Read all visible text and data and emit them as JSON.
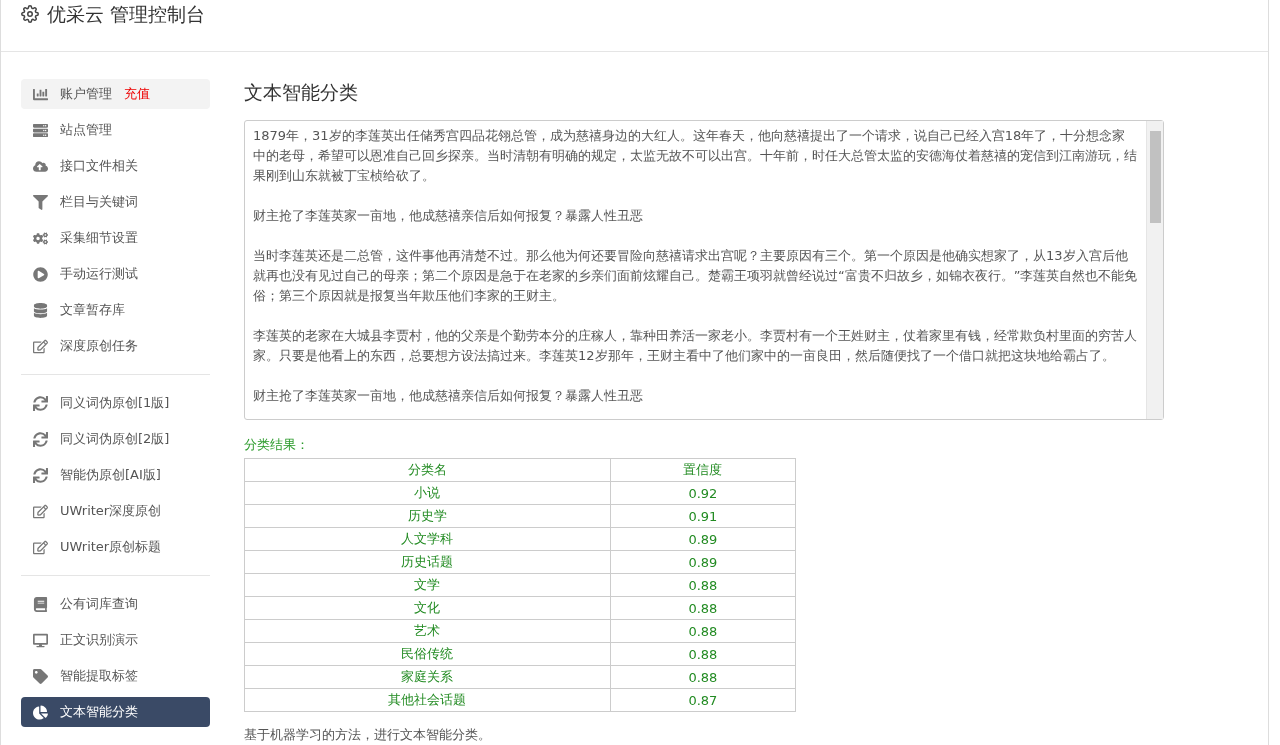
{
  "header": {
    "title": "优采云 管理控制台"
  },
  "sidebar": {
    "groups": [
      {
        "items": [
          {
            "label": "账户管理",
            "badge": "充值",
            "hovered": true,
            "selected": false
          },
          {
            "label": "站点管理",
            "hovered": false,
            "selected": false
          },
          {
            "label": "接口文件相关",
            "hovered": false,
            "selected": false
          },
          {
            "label": "栏目与关键词",
            "hovered": false,
            "selected": false
          },
          {
            "label": "采集细节设置",
            "hovered": false,
            "selected": false
          },
          {
            "label": "手动运行测试",
            "hovered": false,
            "selected": false
          },
          {
            "label": "文章暂存库",
            "hovered": false,
            "selected": false
          },
          {
            "label": "深度原创任务",
            "hovered": false,
            "selected": false
          }
        ]
      },
      {
        "items": [
          {
            "label": "同义词伪原创[1版]",
            "hovered": false,
            "selected": false
          },
          {
            "label": "同义词伪原创[2版]",
            "hovered": false,
            "selected": false
          },
          {
            "label": "智能伪原创[AI版]",
            "hovered": false,
            "selected": false
          },
          {
            "label": "UWriter深度原创",
            "hovered": false,
            "selected": false
          },
          {
            "label": "UWriter原创标题",
            "hovered": false,
            "selected": false
          }
        ]
      },
      {
        "items": [
          {
            "label": "公有词库查询",
            "hovered": false,
            "selected": false
          },
          {
            "label": "正文识别演示",
            "hovered": false,
            "selected": false
          },
          {
            "label": "智能提取标签",
            "hovered": false,
            "selected": false
          },
          {
            "label": "文本智能分类",
            "hovered": false,
            "selected": true
          }
        ]
      }
    ]
  },
  "main": {
    "title": "文本智能分类",
    "text_input": {
      "paragraphs": [
        "1879年，31岁的李莲英出任储秀宫四品花翎总管，成为慈禧身边的大红人。这年春天，他向慈禧提出了一个请求，说自己已经入宫18年了，十分想念家中的老母，希望可以恩准自己回乡探亲。当时清朝有明确的规定，太监无故不可以出宫。十年前，时任大总管太监的安德海仗着慈禧的宠信到江南游玩，结果刚到山东就被丁宝桢给砍了。",
        "财主抢了李莲英家一亩地，他成慈禧亲信后如何报复？暴露人性丑恶",
        "当时李莲英还是二总管，这件事他再清楚不过。那么他为何还要冒险向慈禧请求出宫呢？主要原因有三个。第一个原因是他确实想家了，从13岁入宫后他就再也没有见过自己的母亲；第二个原因是急于在老家的乡亲们面前炫耀自己。楚霸王项羽就曾经说过“富贵不归故乡，如锦衣夜行。”李莲英自然也不能免俗；第三个原因就是报复当年欺压他们李家的王财主。",
        "李莲英的老家在大城县李贾村，他的父亲是个勤劳本分的庄稼人，靠种田养活一家老小。李贾村有一个王姓财主，仗着家里有钱，经常欺负村里面的穷苦人家。只要是他看上的东西，总要想方设法搞过来。李莲英12岁那年，王财主看中了他们家中的一亩良田，然后随便找了一个借口就把这块地给霸占了。",
        "财主抢了李莲英家一亩地，他成慈禧亲信后如何报复？暴露人性丑恶"
      ]
    },
    "result_label": "分类结果：",
    "table": {
      "columns": [
        "分类名",
        "置信度"
      ],
      "rows": [
        [
          "小说",
          "0.92"
        ],
        [
          "历史学",
          "0.91"
        ],
        [
          "人文学科",
          "0.89"
        ],
        [
          "历史话题",
          "0.89"
        ],
        [
          "文学",
          "0.88"
        ],
        [
          "文化",
          "0.88"
        ],
        [
          "艺术",
          "0.88"
        ],
        [
          "民俗传统",
          "0.88"
        ],
        [
          "家庭关系",
          "0.88"
        ],
        [
          "其他社会话题",
          "0.87"
        ]
      ]
    },
    "footnote": "基于机器学习的方法，进行文本智能分类。"
  }
}
